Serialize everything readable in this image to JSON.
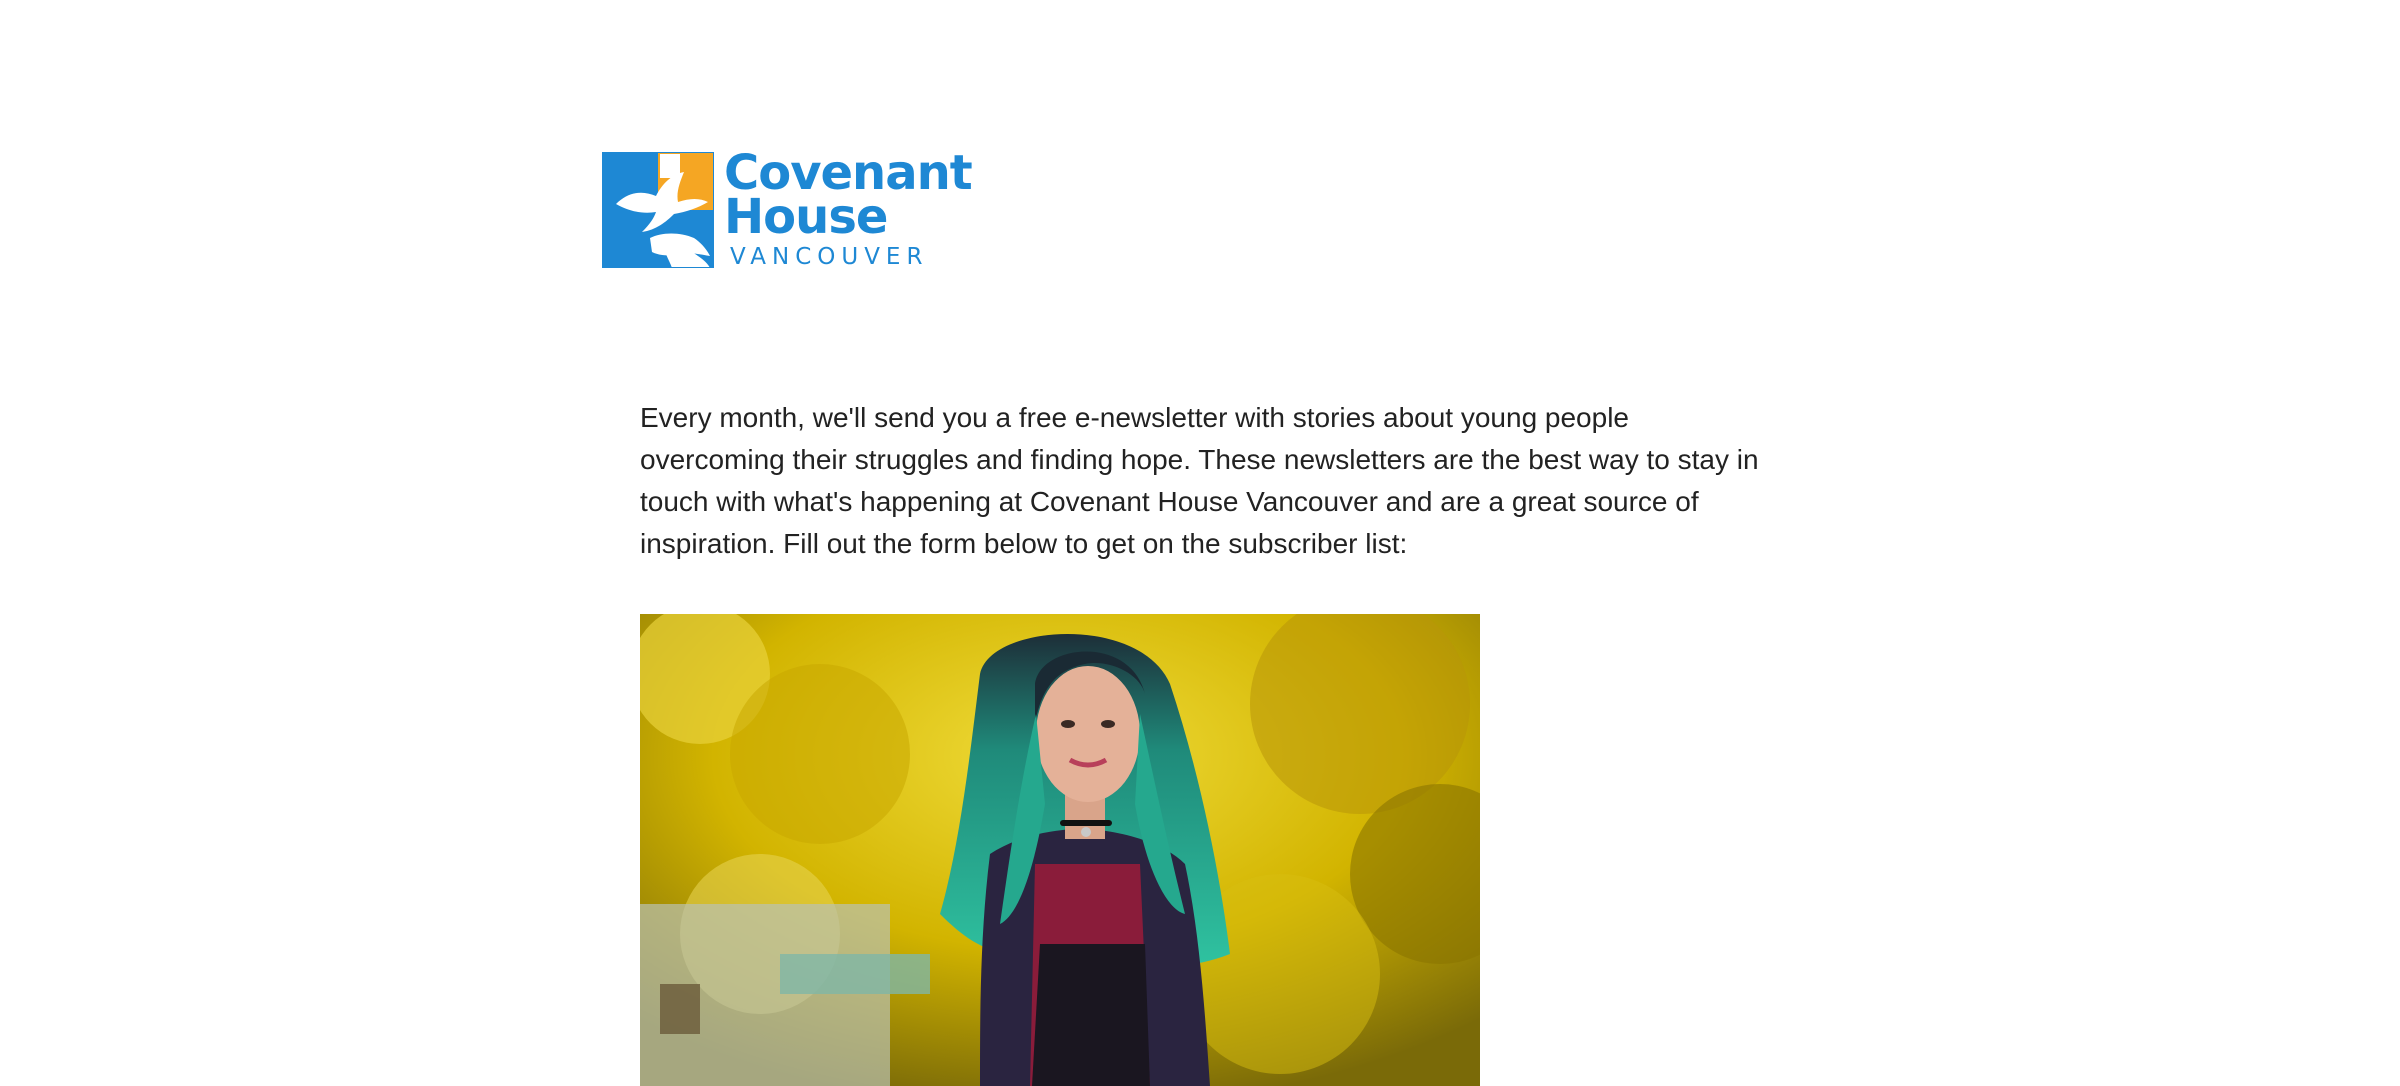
{
  "logo": {
    "line1": "Covenant",
    "line2": "House",
    "line3": "VANCOUVER",
    "brand_blue": "#1e88d4",
    "brand_orange": "#f5a623"
  },
  "intro": {
    "text": "Every month, we'll send you a free e-newsletter with stories about young people overcoming their struggles and finding hope. These newsletters are the best way to stay in touch with what's happening at Covenant House Vancouver and are a great source of inspiration. Fill out the form below to get on the subscriber list:"
  },
  "hero_image": {
    "subject": "young woman with teal hair smiling outdoors in front of yellow autumn trees"
  }
}
